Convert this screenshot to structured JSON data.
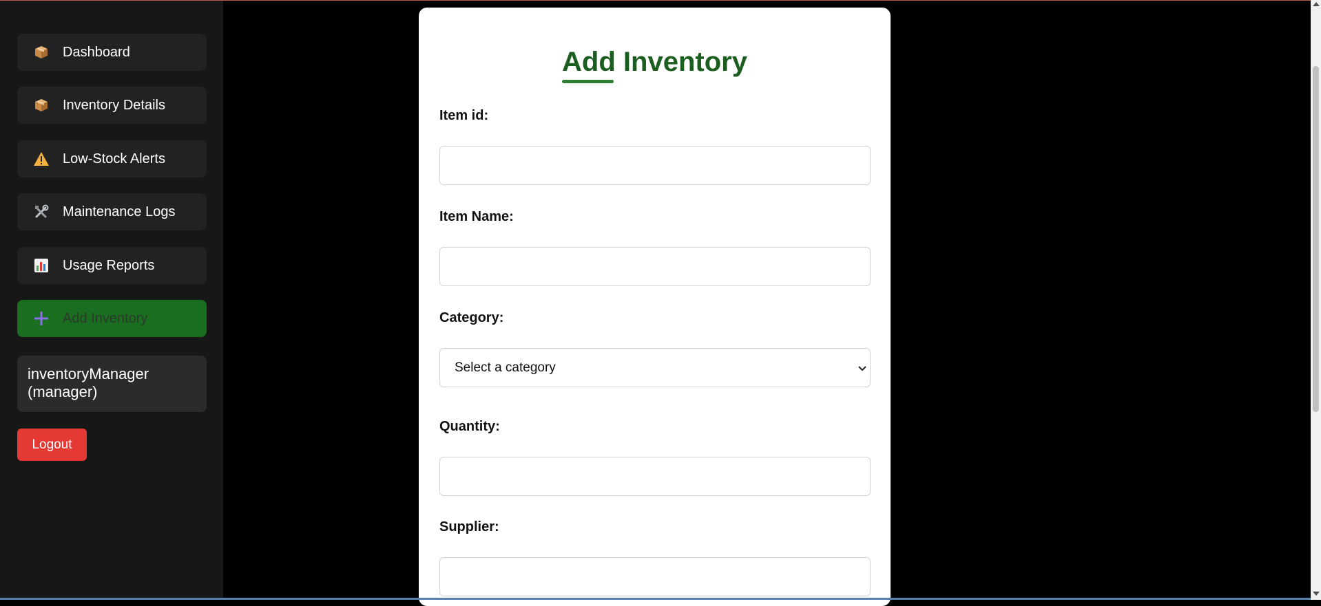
{
  "sidebar": {
    "items": [
      {
        "label": "Dashboard",
        "icon": "package-icon"
      },
      {
        "label": "Inventory Details",
        "icon": "package-icon"
      },
      {
        "label": "Low-Stock Alerts",
        "icon": "warning-icon"
      },
      {
        "label": "Maintenance Logs",
        "icon": "tools-icon"
      },
      {
        "label": "Usage Reports",
        "icon": "bar-chart-icon"
      },
      {
        "label": "Add Inventory",
        "icon": "plus-icon",
        "active": true
      }
    ],
    "user": {
      "name": "inventoryManager",
      "role": "(manager)"
    },
    "logout_label": "Logout"
  },
  "form": {
    "title": "Add Inventory",
    "item_id_label": "Item id:",
    "item_name_label": "Item Name:",
    "category_label": "Category:",
    "category_value": "Select a category",
    "quantity_label": "Quantity:",
    "supplier_label": "Supplier:"
  },
  "colors": {
    "accent": "#1a6e20",
    "title": "#1b5e20",
    "logout": "#e53935",
    "sidebar_bg": "#171717"
  }
}
